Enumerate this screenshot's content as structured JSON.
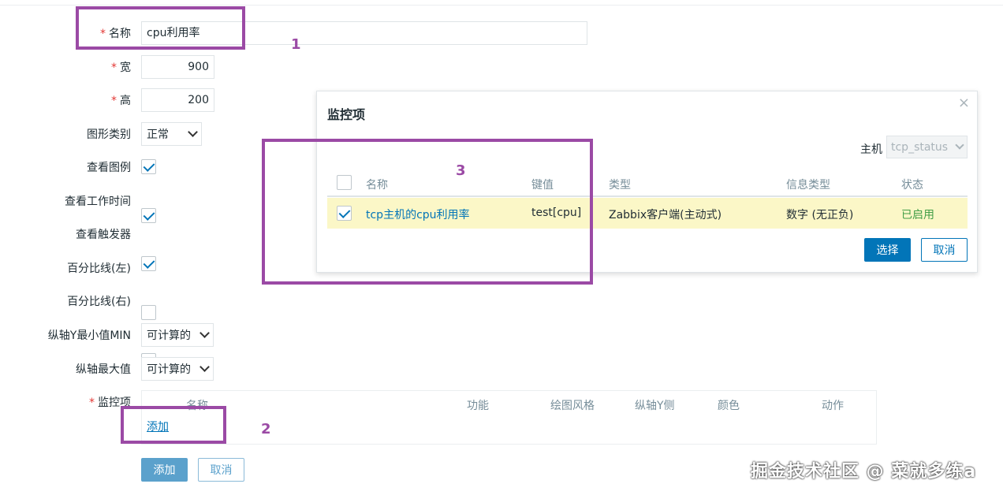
{
  "form": {
    "name": {
      "label": "名称",
      "value": "cpu利用率"
    },
    "width": {
      "label": "宽",
      "value": "900"
    },
    "height": {
      "label": "高",
      "value": "200"
    },
    "graph_type": {
      "label": "图形类别",
      "value": "正常"
    },
    "show_legend": {
      "label": "查看图例",
      "checked": true
    },
    "show_working_time": {
      "label": "查看工作时间",
      "checked": true
    },
    "show_triggers": {
      "label": "查看触发器",
      "checked": true
    },
    "percentile_left": {
      "label": "百分比线(左)",
      "checked": false
    },
    "percentile_right": {
      "label": "百分比线(右)",
      "checked": false
    },
    "y_min": {
      "label": "纵轴Y最小值MIN",
      "value": "可计算的"
    },
    "y_max": {
      "label": "纵轴最大值",
      "value": "可计算的"
    },
    "items": {
      "label": "监控项",
      "columns": [
        "名称",
        "功能",
        "绘图风格",
        "纵轴Y侧",
        "颜色",
        "动作"
      ],
      "add_link": "添加"
    },
    "required_mark": "*",
    "buttons": {
      "add": "添加",
      "cancel": "取消"
    }
  },
  "dialog": {
    "title": "监控项",
    "close_glyph": "×",
    "host_label": "主机",
    "host_value": "tcp_status",
    "columns": [
      "名称",
      "键值",
      "类型",
      "信息类型",
      "状态"
    ],
    "rows": [
      {
        "checked": true,
        "name": "tcp主机的cpu利用率",
        "key": "test[cpu]",
        "type": "Zabbix客户端(主动式)",
        "info_type": "数字 (无正负)",
        "status": "已启用"
      }
    ],
    "buttons": {
      "select": "选择",
      "cancel": "取消"
    }
  },
  "annotations": {
    "one": "1",
    "two": "2",
    "three": "3"
  },
  "watermark": "掘金技术社区 @ 菜就多练a",
  "colors": {
    "accent": "#0275b8",
    "annotation": "#9b4aa5",
    "row_highlight": "#fbf7c7",
    "status_enabled": "#429e47"
  }
}
